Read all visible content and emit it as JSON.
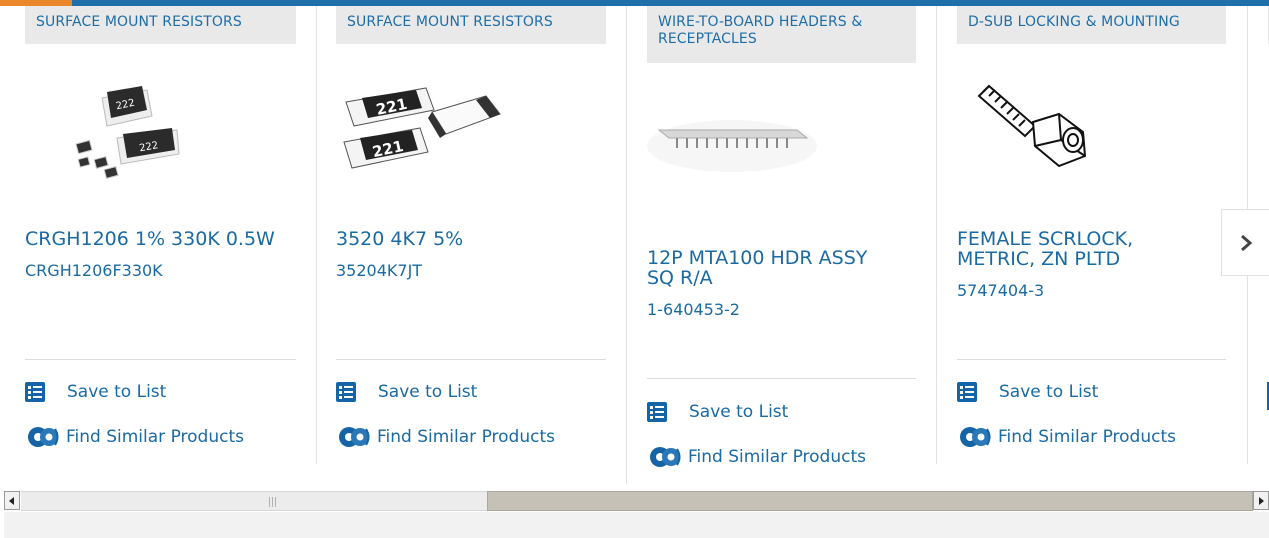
{
  "cards": [
    {
      "category": "SURFACE MOUNT RESISTORS",
      "name": "CRGH1206 1% 330K 0.5W",
      "part_number": "CRGH1206F330K",
      "image_labels": [
        "222",
        "222"
      ],
      "save_label": "Save to List",
      "similar_label": "Find Similar Products"
    },
    {
      "category": "SURFACE MOUNT RESISTORS",
      "name": "3520 4K7 5%",
      "part_number": "35204K7JT",
      "image_labels": [
        "221",
        "221"
      ],
      "save_label": "Save to List",
      "similar_label": "Find Similar Products"
    },
    {
      "category": "WIRE-TO-BOARD HEADERS & RECEPTACLES",
      "name": "12P MTA100 HDR ASSY SQ R/A",
      "part_number": "1-640453-2",
      "save_label": "Save to List",
      "similar_label": "Find Similar Products"
    },
    {
      "category": "D-SUB LOCKING & MOUNTING",
      "name": "FEMALE SCRLOCK, METRIC, ZN PLTD",
      "part_number": "5747404-3",
      "save_label": "Save to List",
      "similar_label": "Find Similar Products"
    }
  ],
  "icons": {
    "next": "chevron-right-icon",
    "save": "checklist-icon",
    "similar": "gears-icon",
    "scroll_left": "triangle-left-icon",
    "scroll_right": "triangle-right-icon"
  },
  "colors": {
    "accent_orange": "#e9872a",
    "brand_blue": "#1f6fa8",
    "link_blue": "#1a6aa3",
    "category_bg": "#e9e9e9"
  }
}
